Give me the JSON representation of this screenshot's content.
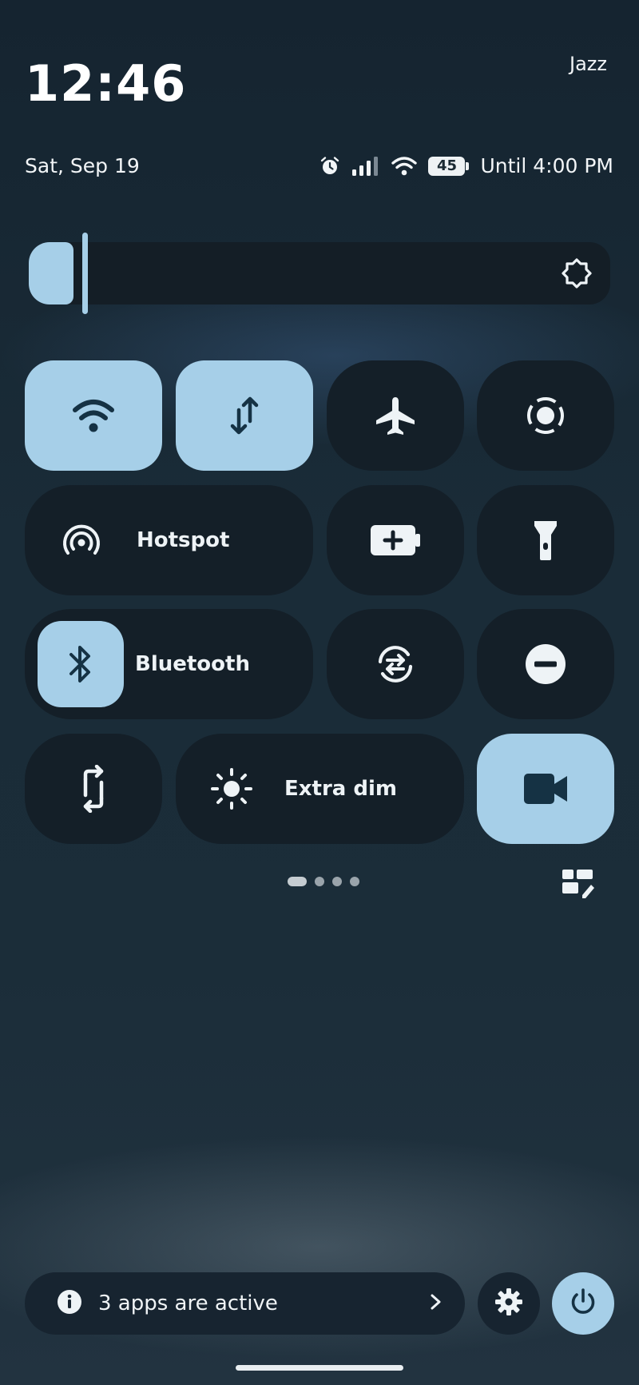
{
  "status": {
    "time": "12:46",
    "carrier": "Jazz",
    "date": "Sat, Sep 19",
    "battery_level": "45",
    "battery_text": "Until 4:00 PM",
    "icons": [
      "alarm-icon",
      "signal-icon",
      "wifi-icon",
      "battery-icon"
    ]
  },
  "brightness": {
    "level": 0.08,
    "icon": "auto-brightness-icon"
  },
  "tiles": {
    "wifi": {
      "icon": "wifi-icon",
      "active": true
    },
    "mobile_data": {
      "icon": "data-arrows-icon",
      "active": true
    },
    "airplane": {
      "icon": "airplane-icon",
      "active": false
    },
    "screen_record": {
      "icon": "screen-record-icon",
      "active": false
    },
    "hotspot": {
      "label": "Hotspot",
      "icon": "hotspot-icon",
      "active": false
    },
    "battery_saver": {
      "icon": "battery-saver-icon",
      "active": false
    },
    "flashlight": {
      "icon": "flashlight-icon",
      "active": false
    },
    "bluetooth": {
      "label": "Bluetooth",
      "icon": "bluetooth-icon",
      "active": true
    },
    "data_saver": {
      "icon": "sync-icon",
      "active": false
    },
    "dnd": {
      "icon": "do-not-disturb-icon",
      "active": false
    },
    "rotate": {
      "icon": "rotate-icon",
      "active": false
    },
    "extra_dim": {
      "label": "Extra dim",
      "icon": "sun-icon",
      "active": false
    },
    "camera": {
      "icon": "video-camera-icon",
      "active": true
    }
  },
  "pager": {
    "pages": 4,
    "current": 1
  },
  "footer": {
    "active_apps": "3 apps are active"
  },
  "colors": {
    "accent": "#a6cfe8",
    "tile_off": "#141f28",
    "background": "#1a2c38"
  }
}
